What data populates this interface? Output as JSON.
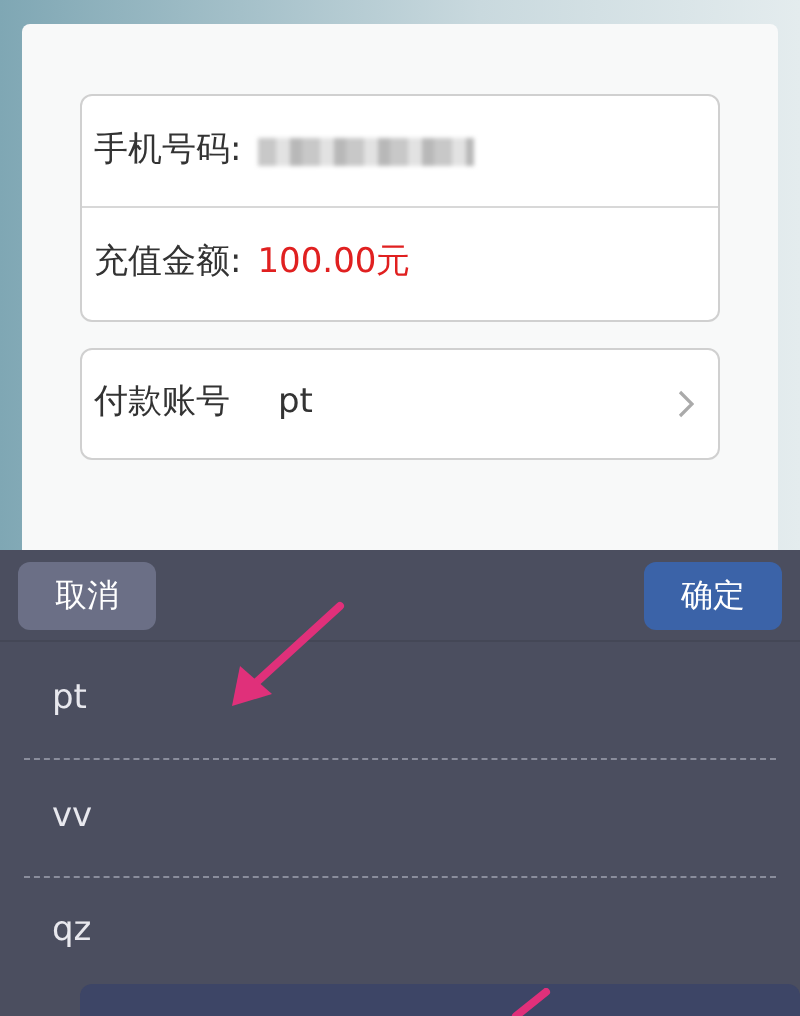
{
  "form": {
    "rows": [
      {
        "label": "手机号码:",
        "kind": "redacted"
      },
      {
        "label": "充值金额:",
        "kind": "amount",
        "value": "100.00元"
      }
    ],
    "account": {
      "label": "付款账号",
      "value": "pt"
    }
  },
  "picker": {
    "cancel": "取消",
    "confirm": "确定",
    "options": [
      "pt",
      "vv",
      "qz"
    ]
  }
}
